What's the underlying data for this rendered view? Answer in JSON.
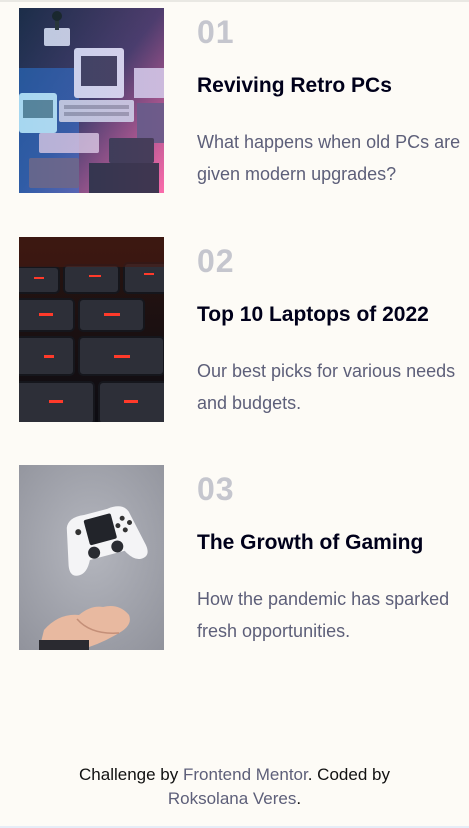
{
  "articles": [
    {
      "number": "01",
      "title": "Reviving Retro PCs",
      "description": "What happens when old PCs are given modern upgrades?",
      "image": "retro-pc-photo"
    },
    {
      "number": "02",
      "title": "Top 10 Laptops of 2022",
      "description": "Our best picks for various needs and budgets.",
      "image": "laptop-keyboard-photo"
    },
    {
      "number": "03",
      "title": "The Growth of Gaming",
      "description": "How the pandemic has sparked fresh opportunities.",
      "image": "gaming-controller-photo"
    }
  ],
  "attribution": {
    "prefix": "Challenge by ",
    "link1": "Frontend Mentor",
    "middle": ". Coded by ",
    "link2": "Roksolana Veres",
    "suffix": "."
  },
  "colors": {
    "background": "#fdfbf6",
    "number": "#c5c6ce",
    "title": "#00001a",
    "description": "#5d5f79"
  }
}
